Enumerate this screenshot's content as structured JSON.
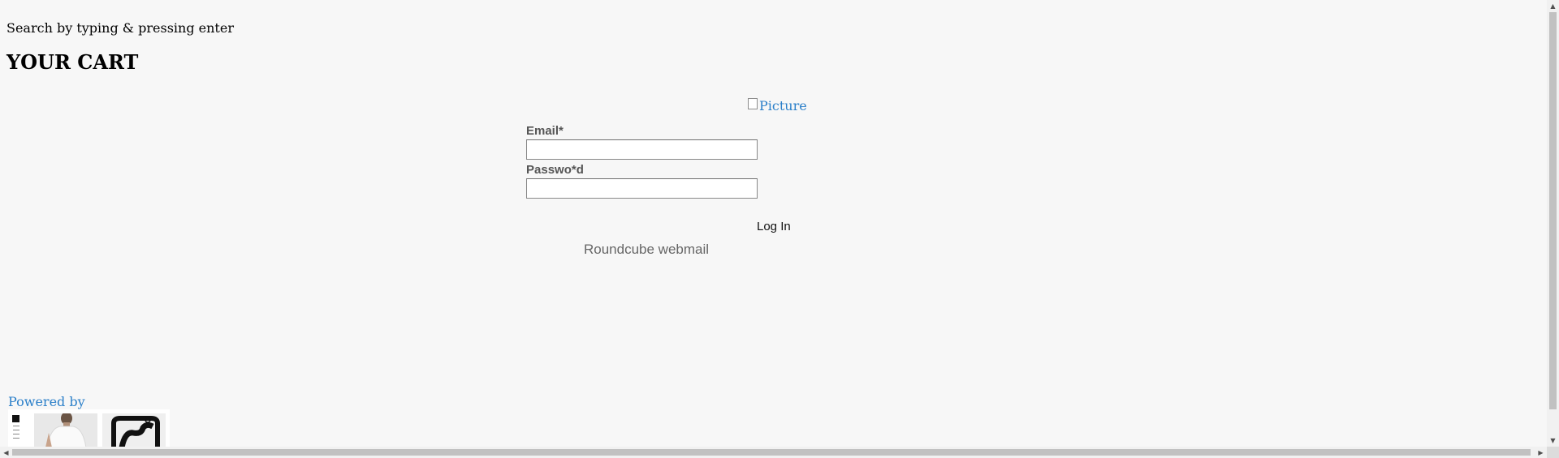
{
  "header": {
    "search_hint": "Search by typing & pressing enter",
    "cart_title": "YOUR CART"
  },
  "login": {
    "picture_alt": "Picture",
    "email_label": "Email*",
    "email_value": "",
    "password_label": "Passwo*d",
    "password_value": "",
    "login_button": "Log In",
    "webmail_text": "Roundcube webmail"
  },
  "footer": {
    "powered_by": "Powered by"
  },
  "colors": {
    "background": "#f7f7f7",
    "link": "#2a7fc9",
    "label": "#555555"
  },
  "icons": {
    "broken_image": "broken-image-icon",
    "scroll_left": "arrow-left-icon",
    "scroll_right": "arrow-right-icon",
    "scroll_up": "arrow-up-icon",
    "scroll_down": "arrow-down-icon"
  }
}
